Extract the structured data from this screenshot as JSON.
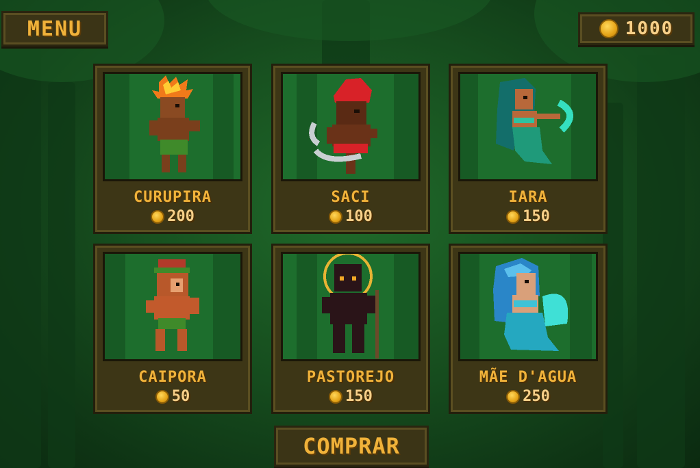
{
  "hud": {
    "menu_label": "MENU",
    "coins": "1000"
  },
  "characters": [
    {
      "name": "CURUPIRA",
      "price": "200"
    },
    {
      "name": "SACI",
      "price": "100"
    },
    {
      "name": "IARA",
      "price": "150"
    },
    {
      "name": "CAIPORA",
      "price": "50"
    },
    {
      "name": "PASTOREJO",
      "price": "150"
    },
    {
      "name": "MÃE D'AGUA",
      "price": "250"
    }
  ],
  "buy_label": "COMPRAR",
  "colors": {
    "accent": "#f0b23a",
    "panel": "#3d3616",
    "forest": "#174f1f"
  }
}
